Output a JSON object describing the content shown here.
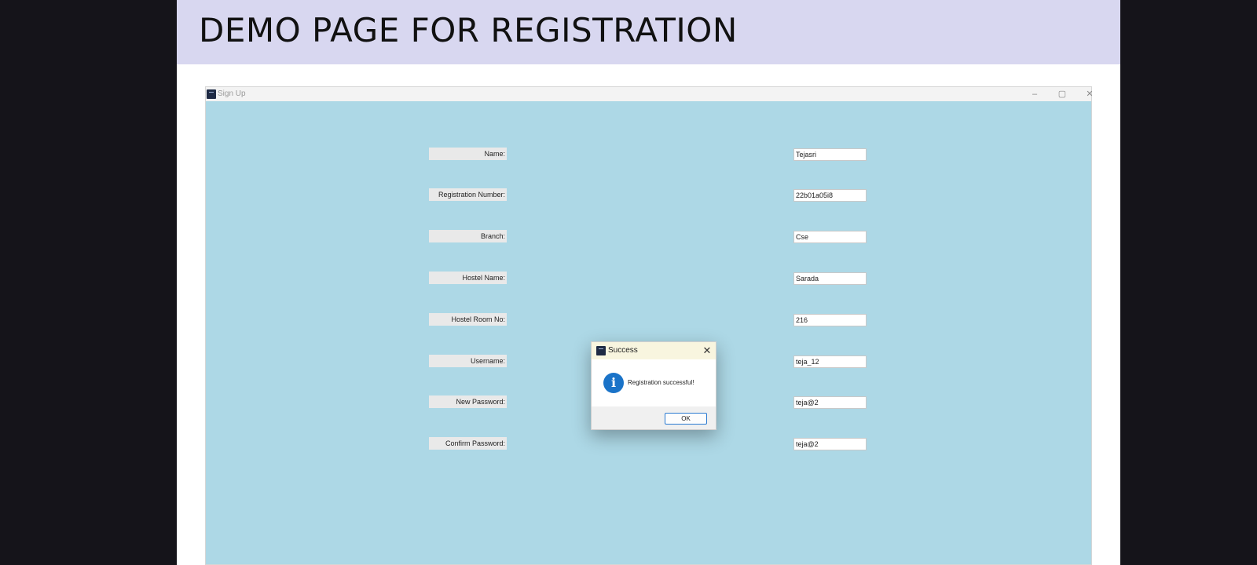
{
  "slide": {
    "title": "DEMO PAGE FOR REGISTRATION"
  },
  "window": {
    "title": "Sign Up",
    "controls": {
      "minimize": "–",
      "maximize": "▢",
      "close": "✕"
    }
  },
  "form": {
    "name": {
      "label": "Name:",
      "value": "Tejasri"
    },
    "registration_number": {
      "label": "Registration Number:",
      "value": "22b01a05i8"
    },
    "branch": {
      "label": "Branch:",
      "value": "Cse"
    },
    "hostel_name": {
      "label": "Hostel Name:",
      "value": "Sarada"
    },
    "hostel_room_no": {
      "label": "Hostel Room No:",
      "value": "216"
    },
    "username": {
      "label": "Username:",
      "value": "teja_12"
    },
    "new_password": {
      "label": "New Password:",
      "value": "teja@2"
    },
    "confirm_password": {
      "label": "Confirm Password:",
      "value": "teja@2"
    }
  },
  "dialog": {
    "title": "Success",
    "close": "✕",
    "icon": "info-icon",
    "icon_glyph": "i",
    "message": "Registration successful!",
    "ok_label": "OK"
  },
  "colors": {
    "window_background": "#add8e6",
    "slide_header": "#d8d7f0",
    "outer_background": "#15141a",
    "info_icon": "#1a73c8",
    "ok_border": "#2a7ad1"
  }
}
